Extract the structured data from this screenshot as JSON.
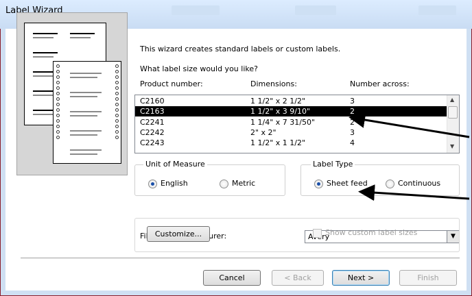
{
  "window": {
    "title": "Label Wizard"
  },
  "intro": {
    "line1": "This wizard creates standard labels or custom labels.",
    "question": "What label size would you like?"
  },
  "list": {
    "headers": {
      "product": "Product number:",
      "dimensions": "Dimensions:",
      "across": "Number across:"
    },
    "rows": [
      {
        "product": "C2160",
        "dimensions": "1 1/2\" x 2 1/2\"",
        "across": "3"
      },
      {
        "product": "C2163",
        "dimensions": "1 1/2\" x 3 9/10\"",
        "across": "2"
      },
      {
        "product": "C2241",
        "dimensions": "1 1/4\" x 7 31/50\"",
        "across": "2"
      },
      {
        "product": "C2242",
        "dimensions": "2\" x 2\"",
        "across": "3"
      },
      {
        "product": "C2243",
        "dimensions": "1 1/2\" x 1 1/2\"",
        "across": "4"
      }
    ],
    "selected_product": "C2163"
  },
  "unit_of_measure": {
    "legend": "Unit of Measure",
    "options": [
      "English",
      "Metric"
    ],
    "selected": "English"
  },
  "label_type": {
    "legend": "Label Type",
    "options": [
      "Sheet feed",
      "Continuous"
    ],
    "selected": "Sheet feed"
  },
  "filter": {
    "label": "Filter by  manufacturer:",
    "value": "Avery"
  },
  "customize": {
    "button": "Customize...",
    "checkbox_label": "Show custom label sizes",
    "checkbox_checked": false
  },
  "buttons": {
    "cancel": "Cancel",
    "back": "< Back",
    "next": "Next >",
    "finish": "Finish"
  },
  "colors": {
    "selection": "#000000",
    "annotation_arrow": "#000000",
    "window_border": "#8b1d2a"
  }
}
